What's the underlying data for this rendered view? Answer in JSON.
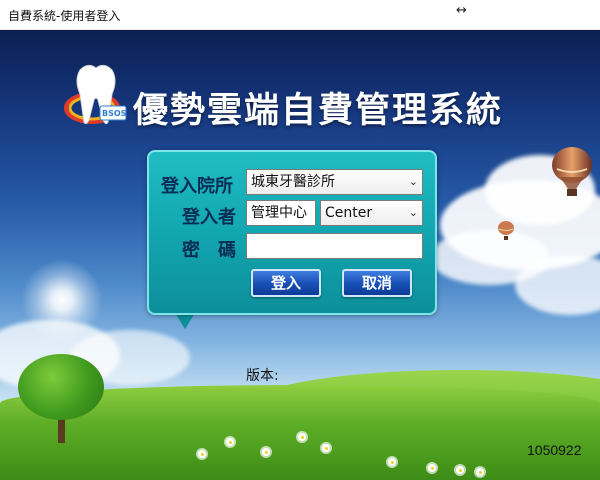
{
  "window": {
    "title": "自費系統-使用者登入"
  },
  "app": {
    "title": "優勢雲端自費管理系統"
  },
  "login": {
    "clinic_label": "登入院所",
    "clinic_value": "城東牙醫診所",
    "user_label": "登入者",
    "user_value": "管理中心",
    "role_value": "Center",
    "password_label": "密　碼",
    "password_value": "",
    "login_button": "登入",
    "cancel_button": "取消"
  },
  "footer": {
    "version_label": "版本:",
    "build_id": "1050922"
  },
  "colors": {
    "panel": "#12a6b0",
    "label": "#0a2d55",
    "button": "#1a52b8"
  },
  "icons": {
    "resize": "resize-horizontal-icon",
    "logo": "tooth-logo-icon",
    "dropdown": "chevron-down-icon"
  }
}
